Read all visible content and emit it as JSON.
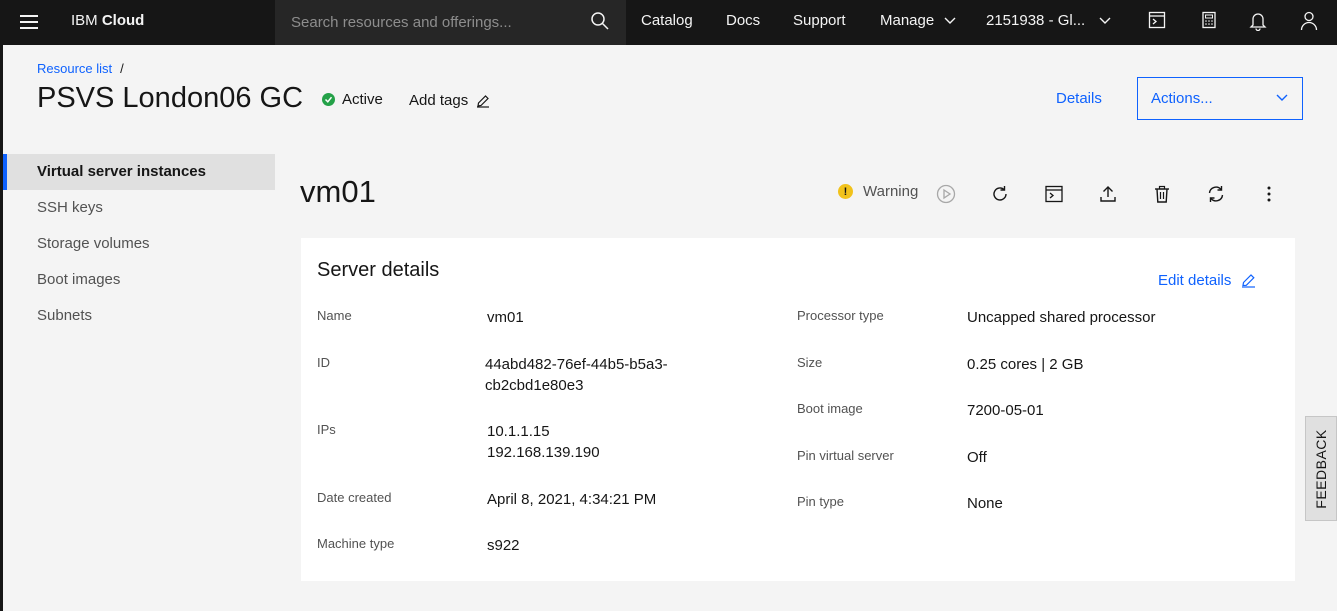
{
  "topbar": {
    "brand_prefix": "IBM",
    "brand_name": "Cloud",
    "search_placeholder": "Search resources and offerings...",
    "links": [
      "Catalog",
      "Docs",
      "Support",
      "Manage"
    ],
    "account": "2151938 - Gl..."
  },
  "breadcrumb": {
    "link": "Resource list",
    "separator": "/"
  },
  "header": {
    "title": "PSVS London06 GC",
    "status": "Active",
    "add_tags": "Add tags",
    "details": "Details",
    "actions": "Actions..."
  },
  "sidebar": {
    "items": [
      {
        "label": "Virtual server instances",
        "active": true
      },
      {
        "label": "SSH keys"
      },
      {
        "label": "Storage volumes"
      },
      {
        "label": "Boot images"
      },
      {
        "label": "Subnets"
      }
    ]
  },
  "instance": {
    "name": "vm01",
    "health": "Warning"
  },
  "server_details": {
    "title": "Server details",
    "edit": "Edit details",
    "left": [
      {
        "label": "Name",
        "value": "vm01"
      },
      {
        "label": "ID",
        "value_line1": "44abd482-76ef-44b5-b5a3-",
        "value_line2": "cb2cbd1e80e3"
      },
      {
        "label": "IPs",
        "value_line1": "10.1.1.15",
        "value_line2": "192.168.139.190"
      },
      {
        "label": "Date created",
        "value": "April 8, 2021, 4:34:21 PM"
      },
      {
        "label": "Machine type",
        "value": "s922"
      }
    ],
    "right": [
      {
        "label": "Processor type",
        "value": "Uncapped shared processor"
      },
      {
        "label": "Size",
        "value": "0.25 cores | 2 GB"
      },
      {
        "label": "Boot image",
        "value": "7200-05-01"
      },
      {
        "label": "Pin virtual server",
        "value": "Off"
      },
      {
        "label": "Pin type",
        "value": "None"
      }
    ]
  },
  "feedback": "FEEDBACK",
  "colors": {
    "accent": "#0f62fe",
    "active": "#24a148",
    "warning": "#f1c21b",
    "topbar": "#161616"
  }
}
